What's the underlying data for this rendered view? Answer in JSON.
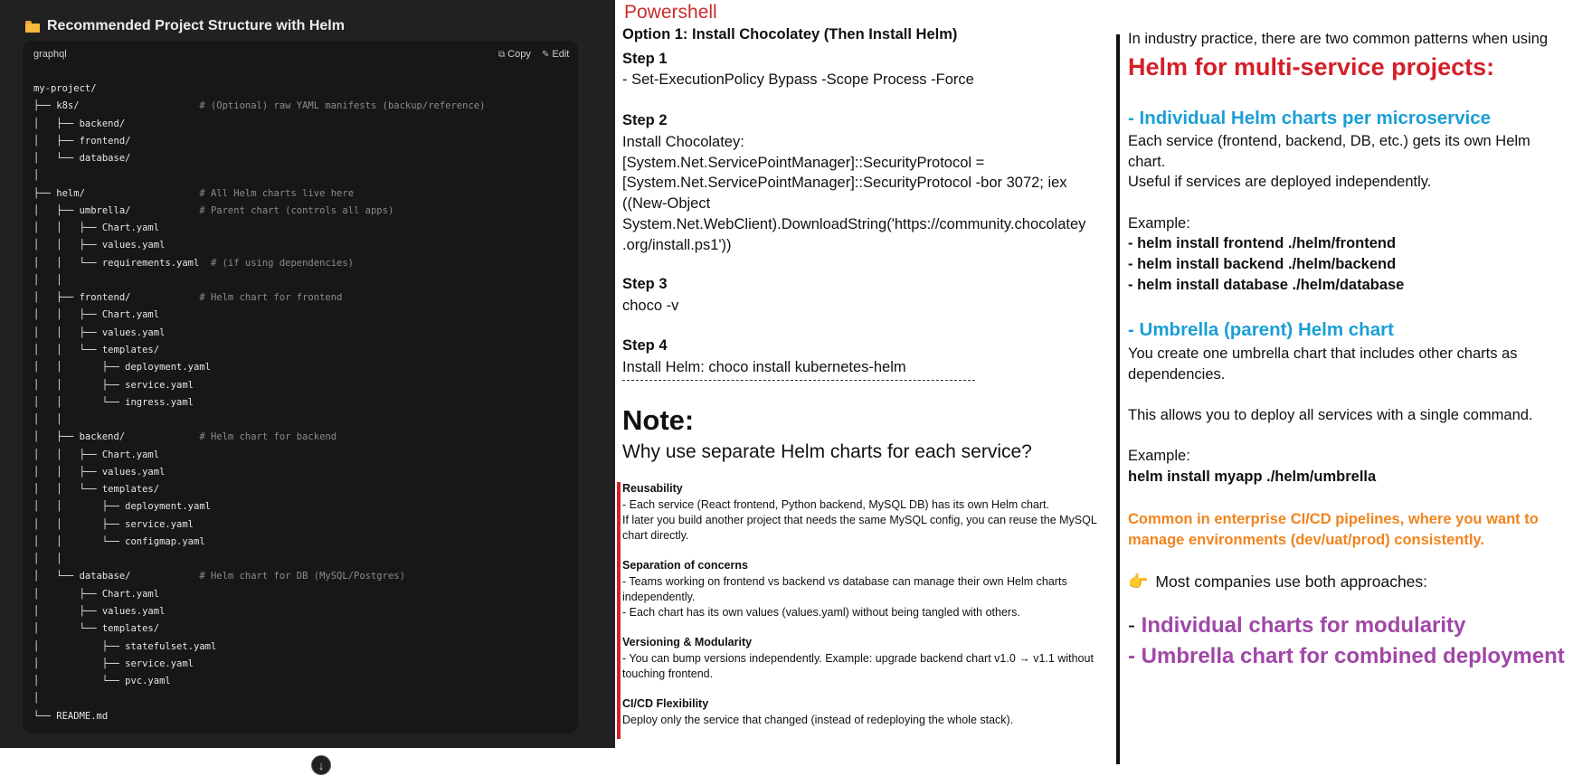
{
  "left": {
    "title": "Recommended Project Structure with Helm",
    "code_lang": "graphql",
    "copy_label": "Copy",
    "edit_label": "Edit",
    "code_lines": [
      {
        "code": "my-project/",
        "comment": ""
      },
      {
        "code": "├── k8s/                     ",
        "comment": "# (Optional) raw YAML manifests (backup/reference)"
      },
      {
        "code": "│   ├── backend/",
        "comment": ""
      },
      {
        "code": "│   ├── frontend/",
        "comment": ""
      },
      {
        "code": "│   └── database/",
        "comment": ""
      },
      {
        "code": "│",
        "comment": ""
      },
      {
        "code": "├── helm/                    ",
        "comment": "# All Helm charts live here"
      },
      {
        "code": "│   ├── umbrella/            ",
        "comment": "# Parent chart (controls all apps)"
      },
      {
        "code": "│   │   ├── Chart.yaml",
        "comment": ""
      },
      {
        "code": "│   │   ├── values.yaml",
        "comment": ""
      },
      {
        "code": "│   │   └── requirements.yaml  ",
        "comment": "# (if using dependencies)"
      },
      {
        "code": "│   │",
        "comment": ""
      },
      {
        "code": "│   ├── frontend/            ",
        "comment": "# Helm chart for frontend"
      },
      {
        "code": "│   │   ├── Chart.yaml",
        "comment": ""
      },
      {
        "code": "│   │   ├── values.yaml",
        "comment": ""
      },
      {
        "code": "│   │   └── templates/",
        "comment": ""
      },
      {
        "code": "│   │       ├── deployment.yaml",
        "comment": ""
      },
      {
        "code": "│   │       ├── service.yaml",
        "comment": ""
      },
      {
        "code": "│   │       └── ingress.yaml",
        "comment": ""
      },
      {
        "code": "│   │",
        "comment": ""
      },
      {
        "code": "│   ├── backend/             ",
        "comment": "# Helm chart for backend"
      },
      {
        "code": "│   │   ├── Chart.yaml",
        "comment": ""
      },
      {
        "code": "│   │   ├── values.yaml",
        "comment": ""
      },
      {
        "code": "│   │   └── templates/",
        "comment": ""
      },
      {
        "code": "│   │       ├── deployment.yaml",
        "comment": ""
      },
      {
        "code": "│   │       ├── service.yaml",
        "comment": ""
      },
      {
        "code": "│   │       └── configmap.yaml",
        "comment": ""
      },
      {
        "code": "│   │",
        "comment": ""
      },
      {
        "code": "│   └── database/            ",
        "comment": "# Helm chart for DB (MySQL/Postgres)"
      },
      {
        "code": "│       ├── Chart.yaml",
        "comment": ""
      },
      {
        "code": "│       ├── values.yaml",
        "comment": ""
      },
      {
        "code": "│       └── templates/",
        "comment": ""
      },
      {
        "code": "│           ├── statefulset.yaml",
        "comment": ""
      },
      {
        "code": "│           ├── service.yaml",
        "comment": ""
      },
      {
        "code": "│           └── pvc.yaml",
        "comment": ""
      },
      {
        "code": "│",
        "comment": ""
      },
      {
        "code": "└── README.md",
        "comment": ""
      }
    ]
  },
  "middle": {
    "powershell": "Powershell",
    "option": "Option 1: Install Chocolatey (Then Install Helm)",
    "step1_title": "Step 1",
    "step1_text": "- Set-ExecutionPolicy Bypass -Scope Process -Force",
    "step2_title": "Step 2",
    "step2_text": "Install Chocolatey:\n[System.Net.ServicePointManager]::SecurityProtocol =\n[System.Net.ServicePointManager]::SecurityProtocol -bor 3072; iex\n((New-Object\nSystem.Net.WebClient).DownloadString('https://community.chocolatey\n.org/install.ps1'))",
    "step3_title": "Step 3",
    "step3_text": "choco -v",
    "step4_title": "Step 4",
    "step4_text": "Install Helm: choco install kubernetes-helm",
    "note_heading": "Note:",
    "note_question": "Why use separate Helm charts for each service?",
    "reasons": [
      {
        "title": "Reusability",
        "text": "- Each service (React frontend, Python backend, MySQL DB) has its own Helm chart.\nIf later you build another project that needs the same MySQL config, you can reuse the MySQL\nchart directly."
      },
      {
        "title": "Separation of concerns",
        "text": "- Teams working on frontend vs backend vs database can manage their own Helm charts\nindependently.\n- Each chart has its own values (values.yaml) without being tangled with others."
      },
      {
        "title": "Versioning & Modularity",
        "text": "- You can bump versions independently. Example: upgrade backend chart v1.0 → v1.1 without\ntouching frontend."
      },
      {
        "title": "CI/CD Flexibility",
        "text": "Deploy only the service that changed (instead of redeploying the whole stack)."
      }
    ]
  },
  "right": {
    "intro": "In industry practice, there are two common patterns when using",
    "heading": "Helm for multi-service projects:",
    "sub1": "- Individual Helm charts per microservice",
    "sub1_text": "Each service (frontend, backend, DB, etc.) gets its own Helm\nchart.\nUseful if services are deployed independently.",
    "example1_label": "Example:",
    "example1_cmds": [
      "- helm install frontend ./helm/frontend",
      "- helm install backend ./helm/backend",
      "- helm install database ./helm/database"
    ],
    "sub2": "- Umbrella (parent) Helm chart",
    "sub2_text": "You create one umbrella chart that includes other charts as\ndependencies.",
    "sub2_text2": "This allows you to deploy all services with a single command.",
    "example2_label": "Example:",
    "example2_cmd": "helm install myapp ./helm/umbrella",
    "enterprise": "Common in enterprise CI/CD pipelines, where you want to\nmanage environments (dev/uat/prod) consistently.",
    "companies": "Most companies use both approaches:",
    "approach1_dash": "- ",
    "approach1": "Individual charts for modularity",
    "approach2": "- Umbrella chart for combined deployment"
  },
  "colors": {
    "powershell_red": "#cc2b2b",
    "heading_red": "#d4202a",
    "sub_blue": "#1a9fd6",
    "enterprise_orange": "#f0841f",
    "approach_purple": "#a047a8"
  }
}
